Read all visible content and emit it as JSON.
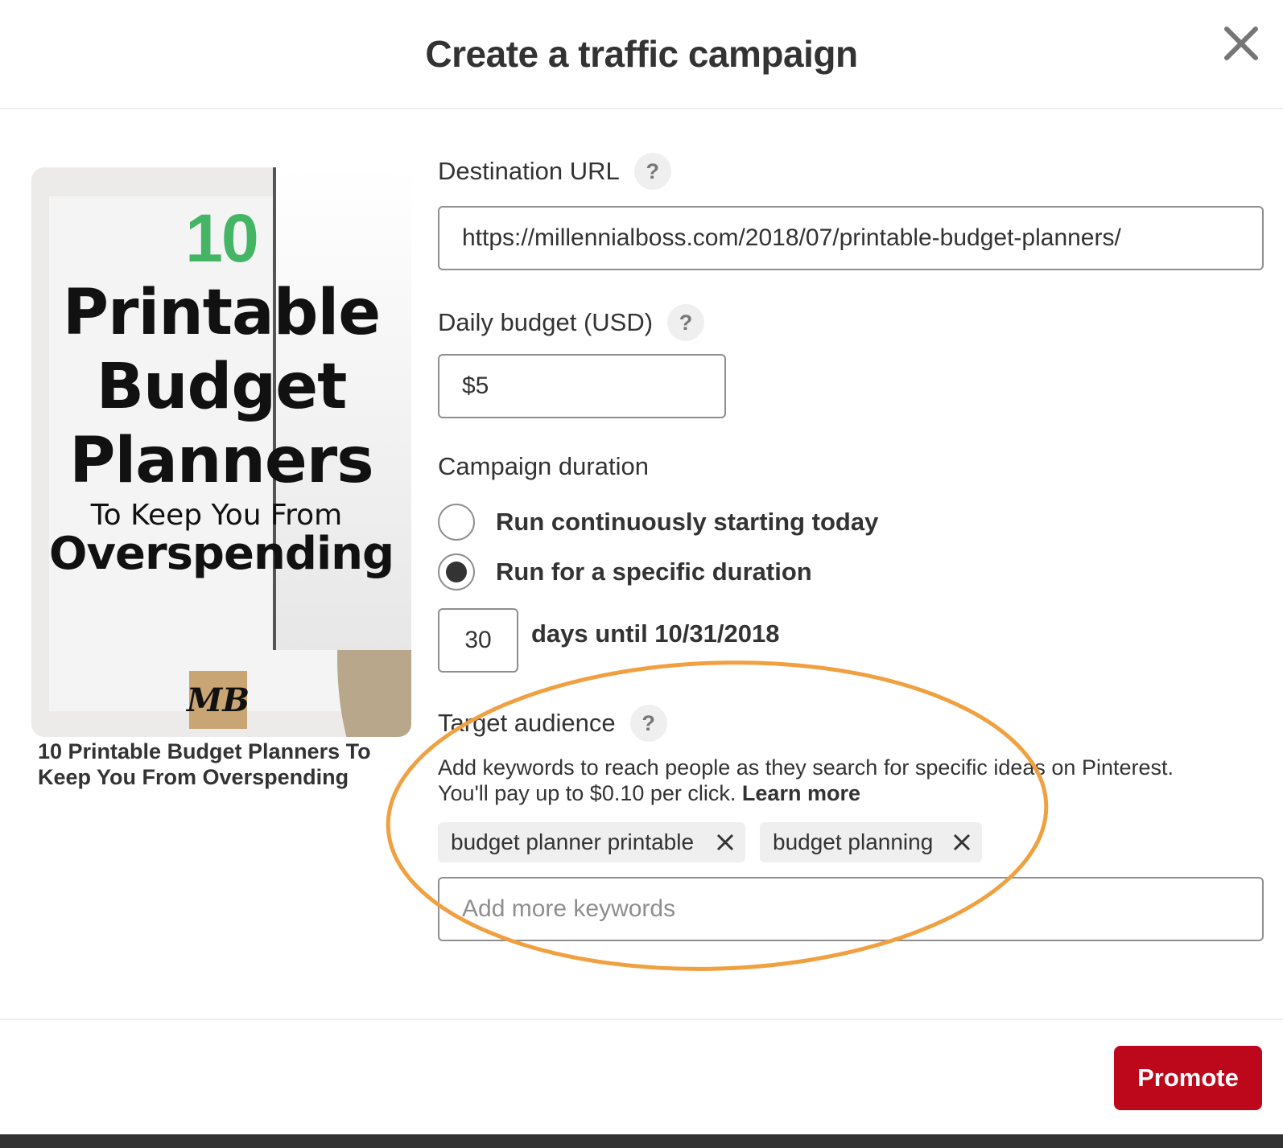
{
  "modal": {
    "title": "Create a traffic campaign"
  },
  "pin": {
    "number": "10",
    "line1": "Printable",
    "line2": "Budget",
    "line3": "Planners",
    "line4": "To Keep You From",
    "line5": "Overspending",
    "logo": "MB",
    "caption": "10 Printable Budget Planners To Keep You From Overspending"
  },
  "destination": {
    "label": "Destination URL",
    "help": "?",
    "value": "https://millennialboss.com/2018/07/printable-budget-planners/"
  },
  "budget": {
    "label": "Daily budget (USD)",
    "help": "?",
    "value": "$5"
  },
  "duration": {
    "label": "Campaign duration",
    "options": [
      {
        "label": "Run continuously starting today",
        "selected": false
      },
      {
        "label": "Run for a specific duration",
        "selected": true
      }
    ],
    "days_value": "30",
    "days_text": "days until 10/31/2018"
  },
  "audience": {
    "label": "Target audience",
    "help": "?",
    "description_line1": "Add keywords to reach people as they search for specific ideas on Pinterest.",
    "description_line2": "You'll pay up to $0.10 per click.",
    "learn_more": "Learn more",
    "keywords": [
      "budget planner printable",
      "budget planning"
    ],
    "input_placeholder": "Add more keywords"
  },
  "footer": {
    "promote_label": "Promote"
  },
  "colors": {
    "promote": "#bd081c",
    "highlight_ellipse": "#f0a040",
    "pin_number": "#43b564"
  }
}
